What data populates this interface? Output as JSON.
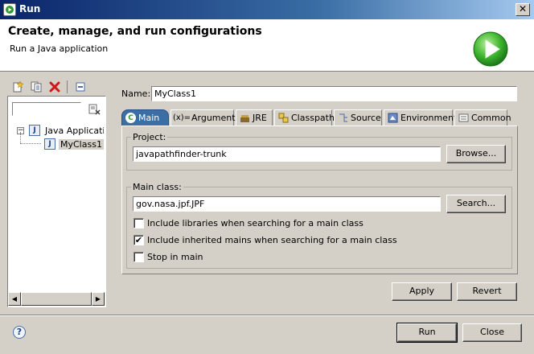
{
  "window": {
    "title": "Run",
    "close_glyph": "✕"
  },
  "header": {
    "title": "Create, manage, and run configurations",
    "subtitle": "Run a Java application",
    "banner_icon": "run-play-icon"
  },
  "left_panel": {
    "toolbar_icons": [
      "new-configuration-icon",
      "duplicate-icon",
      "delete-icon",
      "collapse-all-icon"
    ],
    "filter_placeholder": "",
    "tree": [
      {
        "label": "Java Application",
        "expanded": true,
        "icon": "java-app-icon",
        "children": [
          {
            "label": "MyClass1",
            "selected": true,
            "icon": "java-class-icon"
          }
        ]
      }
    ]
  },
  "config": {
    "name_label": "Name:",
    "name_value": "MyClass1",
    "tabs": [
      {
        "label": "Main",
        "icon": "main-icon",
        "active": true
      },
      {
        "label": "Arguments",
        "icon": "arguments-icon"
      },
      {
        "label": "JRE",
        "icon": "jre-icon"
      },
      {
        "label": "Classpath",
        "icon": "classpath-icon"
      },
      {
        "label": "Source",
        "icon": "source-icon"
      },
      {
        "label": "Environment",
        "icon": "environment-icon"
      },
      {
        "label": "Common",
        "icon": "common-icon"
      }
    ],
    "main": {
      "project_label": "Project:",
      "project_value": "javapathfinder-trunk",
      "browse_label": "Browse...",
      "main_class_label": "Main class:",
      "main_class_value": "gov.nasa.jpf.JPF",
      "search_label": "Search...",
      "options": [
        {
          "label": "Include libraries when searching for a main class",
          "checked": false
        },
        {
          "label": "Include inherited mains when searching for a main class",
          "checked": true
        },
        {
          "label": "Stop in main",
          "checked": false
        }
      ]
    },
    "apply_label": "Apply",
    "revert_label": "Revert"
  },
  "footer": {
    "help_glyph": "?",
    "run_label": "Run",
    "close_label": "Close"
  }
}
